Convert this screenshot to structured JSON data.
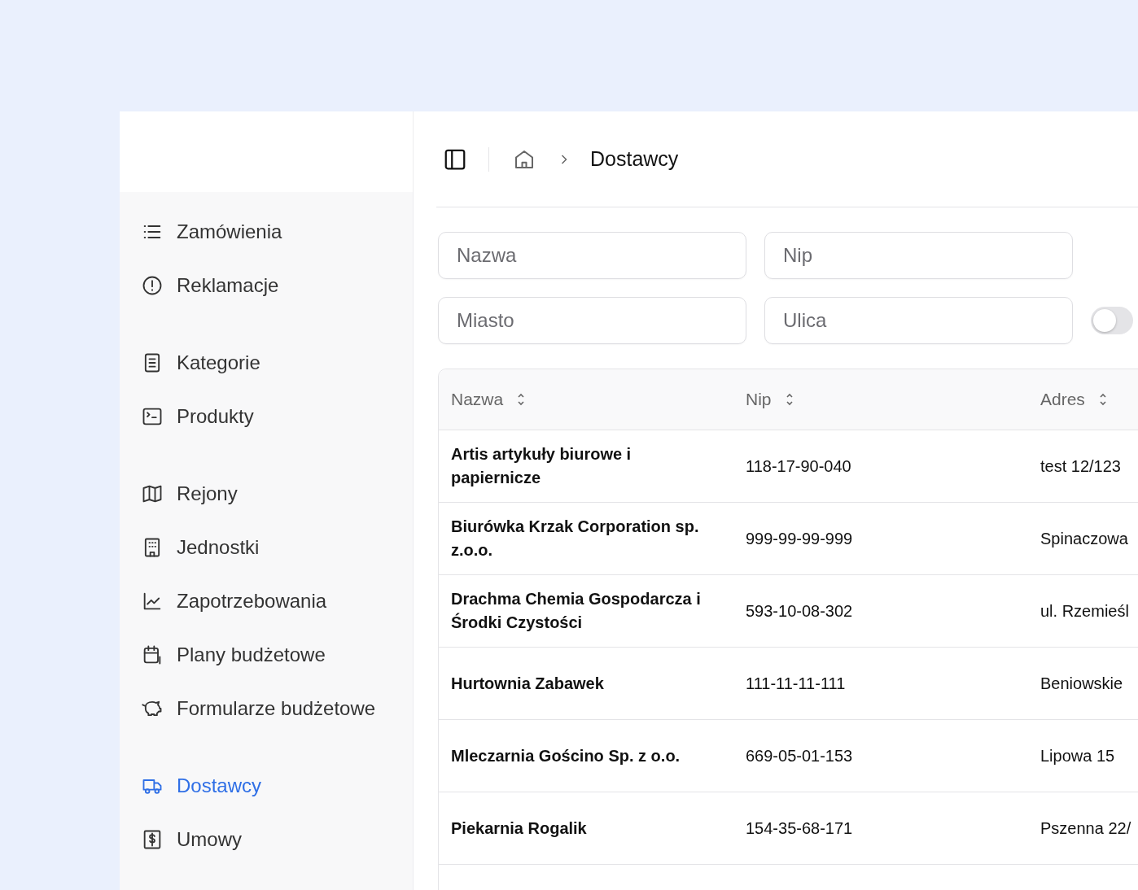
{
  "breadcrumb": {
    "current": "Dostawcy"
  },
  "sidebar": {
    "groups": [
      {
        "items": [
          {
            "label": "Zamówienia",
            "selected": false
          },
          {
            "label": "Reklamacje",
            "selected": false
          }
        ]
      },
      {
        "items": [
          {
            "label": "Kategorie",
            "selected": false
          },
          {
            "label": "Produkty",
            "selected": false
          }
        ]
      },
      {
        "items": [
          {
            "label": "Rejony",
            "selected": false
          },
          {
            "label": "Jednostki",
            "selected": false
          },
          {
            "label": "Zapotrzebowania",
            "selected": false
          },
          {
            "label": "Plany budżetowe",
            "selected": false
          },
          {
            "label": "Formularze budżetowe",
            "selected": false
          }
        ]
      },
      {
        "items": [
          {
            "label": "Dostawcy",
            "selected": true
          },
          {
            "label": "Umowy",
            "selected": false
          }
        ]
      }
    ]
  },
  "filters": {
    "fields": [
      {
        "placeholder": "Nazwa"
      },
      {
        "placeholder": "Nip"
      },
      {
        "placeholder": "Miasto"
      },
      {
        "placeholder": "Ulica"
      }
    ],
    "toggle": {
      "on": false
    }
  },
  "table": {
    "columns": [
      "Nazwa",
      "Nip",
      "Adres"
    ],
    "rows": [
      {
        "name": "Artis artykuły biurowe i papiernicze",
        "nip": "118-17-90-040",
        "address": "test 12/123"
      },
      {
        "name": "Biurówka Krzak Corporation sp. z.o.o.",
        "nip": "999-99-99-999",
        "address": "Spinaczowa"
      },
      {
        "name": "Drachma Chemia Gospodarcza i Środki Czystości",
        "nip": "593-10-08-302",
        "address": "ul. Rzemieśl"
      },
      {
        "name": "Hurtownia Zabawek",
        "nip": "111-11-11-111",
        "address": "Beniowskie"
      },
      {
        "name": "Mleczarnia Gościno Sp. z o.o.",
        "nip": "669-05-01-153",
        "address": "Lipowa 15"
      },
      {
        "name": "Piekarnia Rogalik",
        "nip": "154-35-68-171",
        "address": "Pszenna 22/"
      }
    ]
  }
}
